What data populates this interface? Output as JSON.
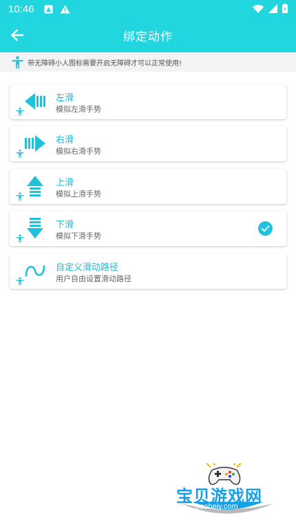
{
  "status_bar": {
    "time": "10:46",
    "icons": [
      "notification-icon",
      "warning-icon",
      "wifi-icon",
      "signal-icon",
      "battery-icon"
    ]
  },
  "header": {
    "title": "绑定动作",
    "back_icon": "arrow-left-icon",
    "background": "#22d6df"
  },
  "notice": {
    "text": "带无障碍小人图标需要开启无障碍才可以正常使用!",
    "icon": "accessibility-icon"
  },
  "gestures": [
    {
      "title": "左滑",
      "subtitle": "模拟左滑手势",
      "icon": "swipe-left-icon",
      "selected": false
    },
    {
      "title": "右滑",
      "subtitle": "模拟右滑手势",
      "icon": "swipe-right-icon",
      "selected": false
    },
    {
      "title": "上滑",
      "subtitle": "模拟上滑手势",
      "icon": "swipe-up-icon",
      "selected": false
    },
    {
      "title": "下滑",
      "subtitle": "模拟下滑手势",
      "icon": "swipe-down-icon",
      "selected": true
    },
    {
      "title": "自定义滑动路径",
      "subtitle": "用户自由设置滑动路径",
      "icon": "custom-path-icon",
      "selected": false
    }
  ],
  "watermark": {
    "text": "宝贝游戏网",
    "url": "baobeiy.com"
  },
  "colors": {
    "accent": "#22d6df",
    "title_text": "#1fb8d8",
    "subtitle_text": "#666666"
  }
}
